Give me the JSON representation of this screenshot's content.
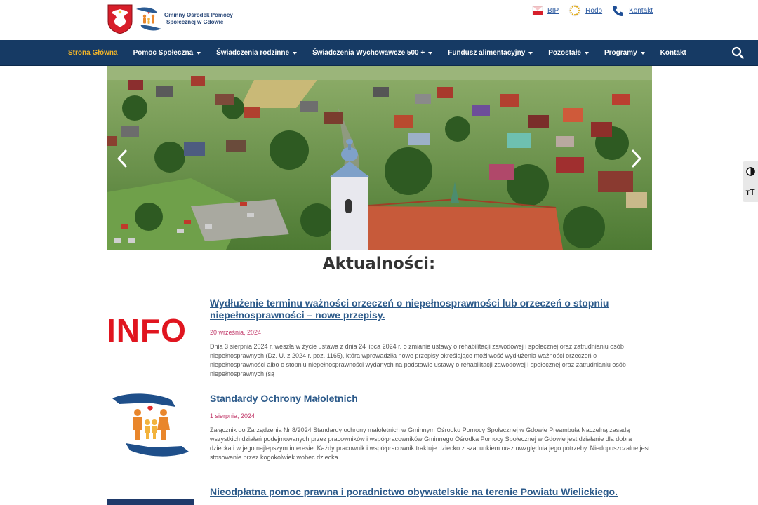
{
  "header": {
    "logo_text_line1": "Gminny Ośrodek Pomocy",
    "logo_text_line2": "Społecznej w Gdowie",
    "links": [
      {
        "label": "BIP",
        "icon": "bip-icon"
      },
      {
        "label": "Rodo",
        "icon": "eu-stars-icon"
      },
      {
        "label": "Kontakt",
        "icon": "phone-icon"
      }
    ]
  },
  "nav": {
    "items": [
      {
        "label": "Strona Główna",
        "active": true,
        "dropdown": false
      },
      {
        "label": "Pomoc Społeczna",
        "active": false,
        "dropdown": true
      },
      {
        "label": "Świadczenia rodzinne",
        "active": false,
        "dropdown": true
      },
      {
        "label": "Świadczenia Wychowawcze 500 +",
        "active": false,
        "dropdown": true
      },
      {
        "label": "Fundusz alimentacyjny",
        "active": false,
        "dropdown": true
      },
      {
        "label": "Pozostałe",
        "active": false,
        "dropdown": true
      },
      {
        "label": "Programy",
        "active": false,
        "dropdown": true
      },
      {
        "label": "Kontakt",
        "active": false,
        "dropdown": false
      }
    ],
    "colors": {
      "bar": "#163a64",
      "active": "#f0b429"
    }
  },
  "a11y": {
    "contrast_icon": "contrast-icon",
    "font_size_label": "тT"
  },
  "section_title": "Aktualności:",
  "posts": [
    {
      "thumb": "INFO",
      "title": "Wydłużenie terminu ważności orzeczeń o niepełnosprawności lub orzeczeń o stopniu niepełnosprawności – nowe przepisy.",
      "date": "20 września, 2024",
      "excerpt": "Dnia 3 sierpnia 2024 r. weszła w życie ustawa z dnia 24 lipca 2024 r. o zmianie ustawy o rehabilitacji zawodowej i społecznej oraz zatrudnianiu osób niepełnosprawnych (Dz. U. z 2024 r. poz. 1165), która wprowadziła nowe przepisy określające możliwość wydłużenia ważności orzeczeń o niepełnosprawności albo o stopniu niepełnosprawności wydanych na podstawie ustawy o rehabilitacji zawodowej i społecznej oraz zatrudnianiu osób niepełnosprawnych (są"
    },
    {
      "thumb": "family-hands-icon",
      "title": "Standardy Ochrony Małoletnich",
      "date": "1 sierpnia, 2024",
      "excerpt": "Załącznik do Zarządzenia Nr 8/2024 Standardy ochrony małoletnich w Gminnym Ośrodku Pomocy Społecznej w Gdowie Preambuła Naczelną zasadą wszystkich działań podejmowanych przez pracowników i współpracowników Gminnego Ośrodka Pomocy Społecznej w Gdowie jest działanie dla dobra dziecka i w jego najlepszym interesie. Każdy pracownik i współpracownik traktuje dziecko z szacunkiem oraz uwzględnia jego potrzeby. Niedopuszczalne jest stosowanie przez kogokolwiek wobec dziecka"
    },
    {
      "thumb": "blue-banner",
      "title": "Nieodpłatna pomoc prawna i poradnictwo obywatelskie na terenie Powiatu Wielickiego.",
      "date": "",
      "excerpt": ""
    }
  ]
}
